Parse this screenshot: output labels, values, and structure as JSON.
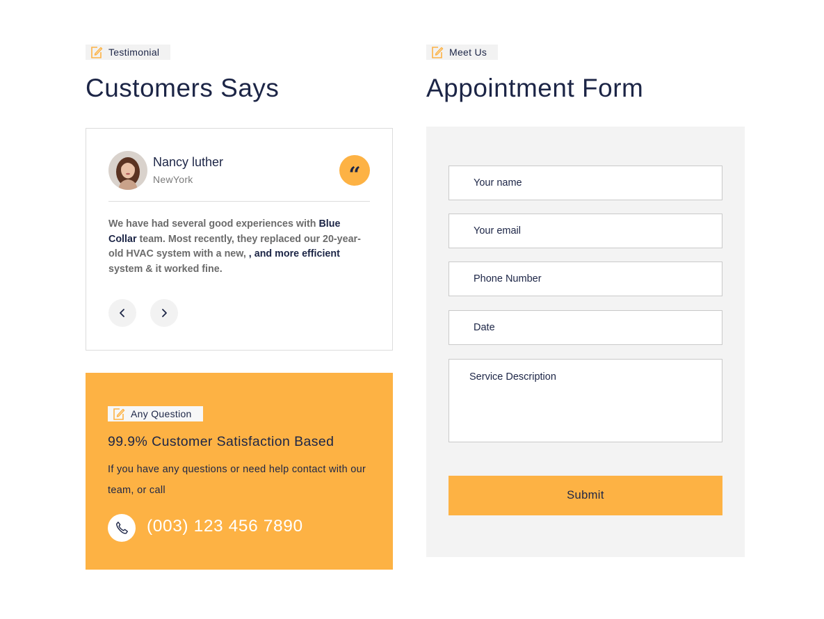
{
  "testimonial": {
    "tag_label": "Testimonial",
    "heading": "Customers Says",
    "reviewer_name": "Nancy luther",
    "reviewer_location": "NewYork",
    "quote_mark": "“",
    "review_parts": [
      {
        "text": "We have had several good experiences with ",
        "highlight": false
      },
      {
        "text": "Blue Collar",
        "highlight": true
      },
      {
        "text": " team. Most recently, they replaced our 20-year-old HVAC system with a new, ",
        "highlight": false
      },
      {
        "text": ", and more efficient",
        "highlight": true
      },
      {
        "text": " system & it worked fine.",
        "highlight": false
      }
    ],
    "prev_icon": "chevron-left-icon",
    "next_icon": "chevron-right-icon"
  },
  "question": {
    "tag_label": "Any Question",
    "title": "99.9% Customer Satisfaction Based",
    "description": "If you have any questions or need help contact with our team, or call",
    "phone": "(003) 123 456 7890",
    "phone_icon": "phone-icon"
  },
  "appointment": {
    "tag_label": "Meet Us",
    "heading": "Appointment Form",
    "fields": {
      "name_placeholder": "Your name",
      "email_placeholder": "Your email",
      "phone_placeholder": "Phone Number",
      "date_placeholder": "Date",
      "description_placeholder": "Service Description"
    },
    "submit_label": "Submit"
  },
  "colors": {
    "accent": "#fdb244",
    "text_dark": "#1c2546",
    "text_muted": "#6b6b6b",
    "panel_bg": "#f3f3f3",
    "tag_bg": "#f2f2f2"
  }
}
